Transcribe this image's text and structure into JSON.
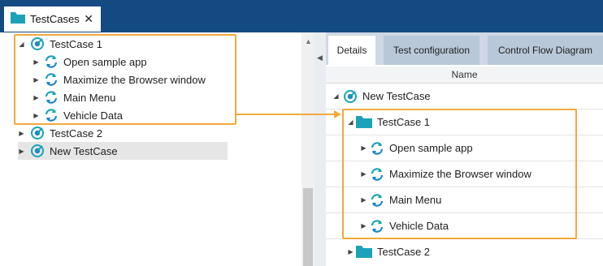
{
  "window": {
    "doc_tab": {
      "label": "TestCases",
      "close_glyph": "✕"
    }
  },
  "left_tree": {
    "items": [
      {
        "label": "TestCase 1",
        "icon": "testcase-icon",
        "expanded": true
      },
      {
        "label": "Open sample app",
        "icon": "sync-icon"
      },
      {
        "label": "Maximize the Browser window",
        "icon": "sync-icon"
      },
      {
        "label": "Main Menu",
        "icon": "sync-icon"
      },
      {
        "label": "Vehicle Data",
        "icon": "sync-icon"
      },
      {
        "label": "TestCase 2",
        "icon": "testcase-icon"
      },
      {
        "label": "New TestCase",
        "icon": "testcase-icon",
        "selected": true
      }
    ]
  },
  "right_panel": {
    "tabs": [
      {
        "label": "Details",
        "active": true
      },
      {
        "label": "Test configuration",
        "active": false
      },
      {
        "label": "Control Flow Diagram",
        "active": false
      }
    ],
    "column_header": "Name",
    "rows": [
      {
        "label": "New TestCase",
        "icon": "testcase-icon"
      },
      {
        "label": "TestCase 1",
        "icon": "folder-icon"
      },
      {
        "label": "Open sample app",
        "icon": "sync-icon"
      },
      {
        "label": "Maximize the Browser window",
        "icon": "sync-icon"
      },
      {
        "label": "Main Menu",
        "icon": "sync-icon"
      },
      {
        "label": "Vehicle Data",
        "icon": "sync-icon"
      },
      {
        "label": "TestCase 2",
        "icon": "folder-icon"
      }
    ]
  },
  "colors": {
    "title_bar": "#144a82",
    "highlight": "#f2a93b",
    "icon_teal": "#1aa3b8",
    "icon_blue": "#1b86c9"
  }
}
